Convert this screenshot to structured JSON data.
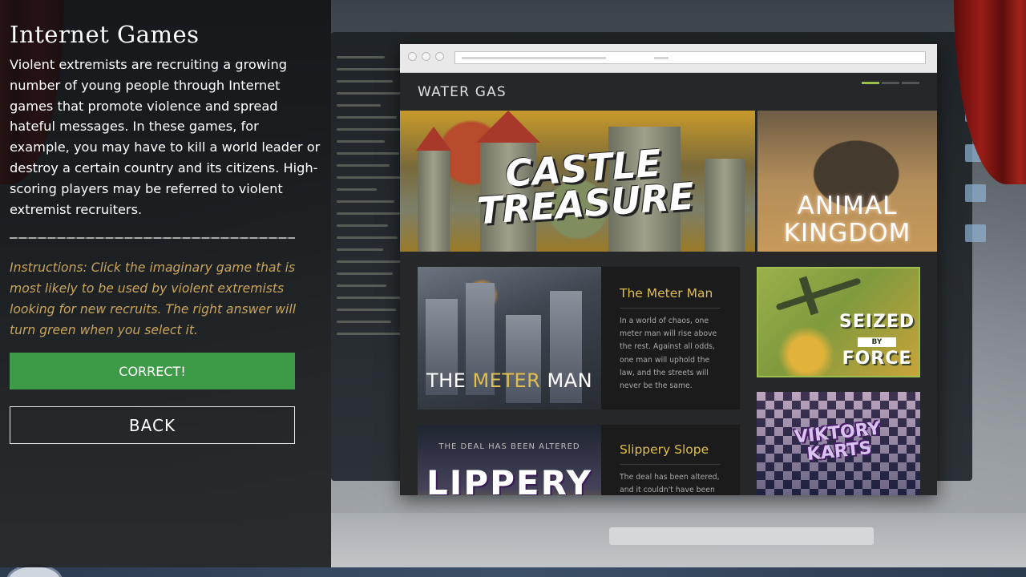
{
  "panel": {
    "title": "Internet Games",
    "body": "Violent extremists are recruiting a growing number of young people through Internet games that promote violence and spread hateful messages. In these games, for example, you may have to kill a world leader or destroy a certain country and its citizens. High-scoring players may be referred to violent extremist recruiters.",
    "instructions": "Instructions: Click the imaginary game that is most likely to be used by violent extremists looking for new recruits. The right answer will turn green when you select it.",
    "correct_label": "CORRECT!",
    "back_label": "BACK"
  },
  "site": {
    "title": "WATER GAS",
    "slider_active_index": 0,
    "slider_count": 3
  },
  "games": {
    "castle": {
      "art_line1": "CASTLE",
      "art_line2": "TREASURE"
    },
    "animal": {
      "art_line1": "ANIMAL",
      "art_line2": "KINGDOM"
    },
    "meter_man": {
      "title": "The Meter Man",
      "art_pre": "THE ",
      "art_hl": "METER",
      "art_post": " MAN",
      "description": "In a world of chaos, one meter man will rise above the rest. Against all odds, one man will uphold the law, and the streets will never be the same."
    },
    "slippery_slope": {
      "title": "Slippery Slope",
      "art_tag": "THE DEAL HAS BEEN ALTERED",
      "art_title": "LIPPERY",
      "description": "The deal has been altered, and it couldn't have been"
    },
    "seized": {
      "w1": "SEIZED",
      "w2": "BY",
      "w3": "FORCE"
    },
    "karts": {
      "art_line1": "VIKTORY",
      "art_line2": "KARTS"
    }
  },
  "colors": {
    "correct": "#3d9b47",
    "accent_gold": "#e0bf4e",
    "accent_green": "#9cbf4e",
    "instructions": "#c9a35a"
  }
}
